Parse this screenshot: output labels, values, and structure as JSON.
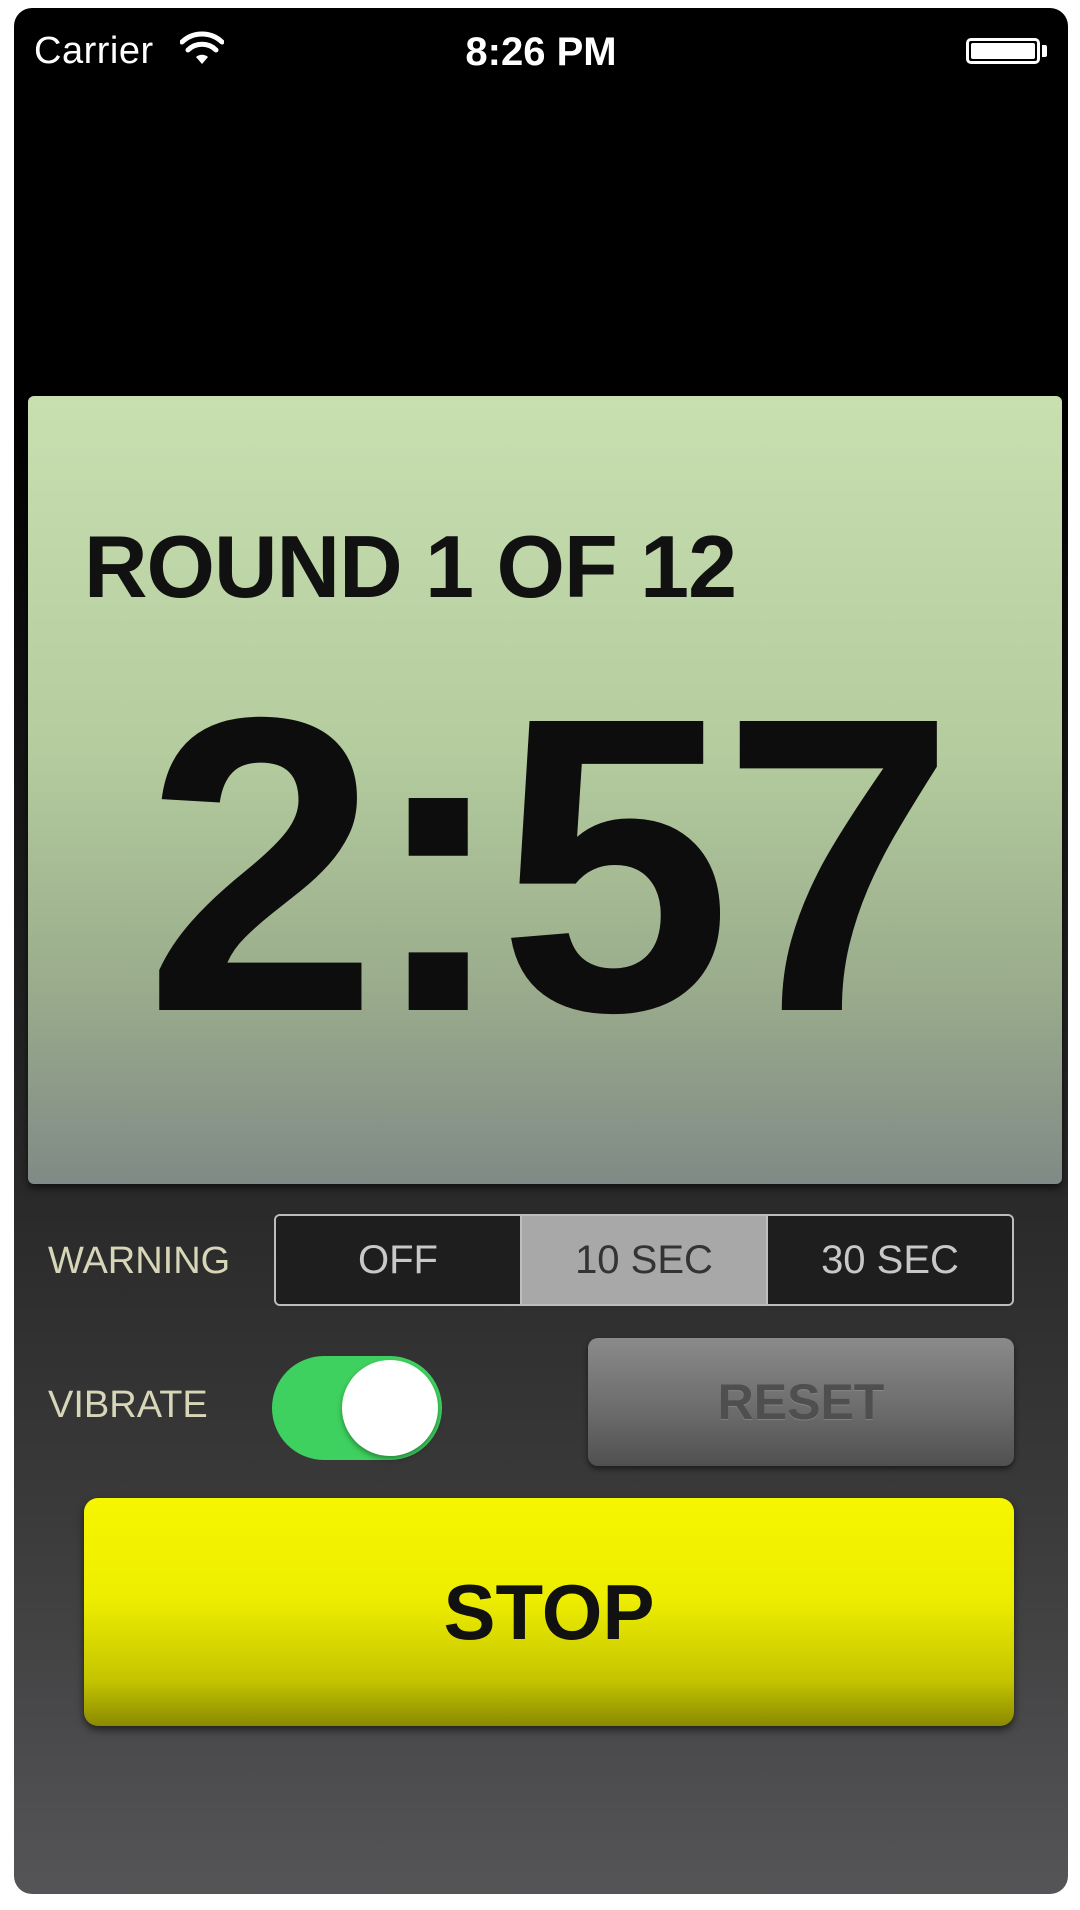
{
  "status_bar": {
    "carrier": "Carrier",
    "time": "8:26 PM",
    "wifi_icon": "wifi-icon",
    "battery_icon": "battery-icon"
  },
  "display": {
    "round_text": "ROUND 1 OF 12",
    "timer": "2:57"
  },
  "warning": {
    "label": "WARNING",
    "options": [
      "OFF",
      "10 SEC",
      "30 SEC"
    ],
    "selected": "10 SEC"
  },
  "vibrate": {
    "label": "VIBRATE",
    "enabled": true
  },
  "buttons": {
    "reset_label": "RESET",
    "stop_label": "STOP"
  },
  "colors": {
    "toggle_on": "#3fd15f",
    "stop_button": "#eded00",
    "display_top": "#c8e0b0"
  }
}
